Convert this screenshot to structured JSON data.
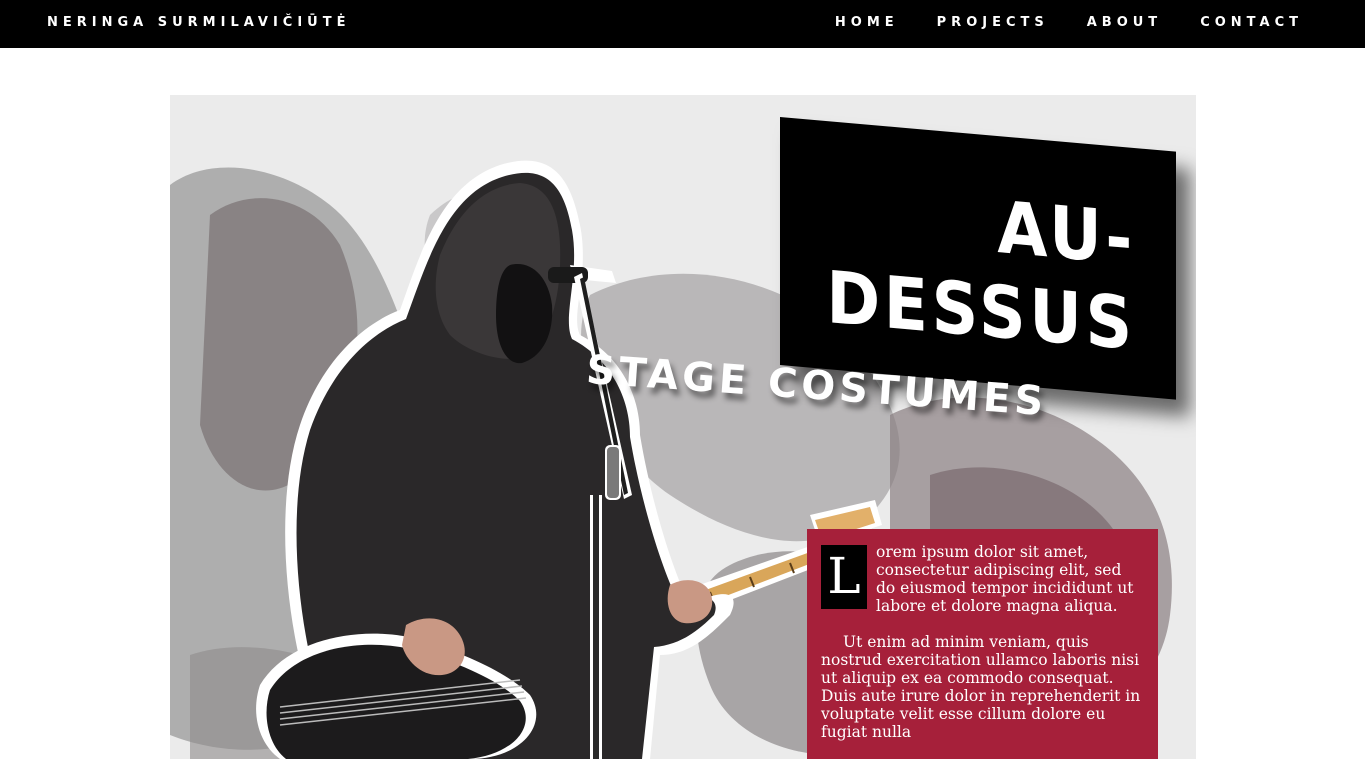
{
  "nav": {
    "brand": "NERINGA SURMILAVIČIŪTĖ",
    "links": [
      "HOME",
      "PROJECTS",
      "ABOUT",
      "CONTACT"
    ]
  },
  "hero": {
    "title_line_1": "AU-",
    "title_line_2": "DESSUS",
    "subtitle": "STAGE COSTUMES",
    "image_subject": "hooded bass guitarist at microphone stand"
  },
  "text_panel": {
    "dropcap": "L",
    "paragraph_1": "orem ipsum dolor sit amet, consectetur adipiscing elit, sed do eiusmod tempor incididunt ut labore et dolore magna aliqua.",
    "paragraph_2": "Ut enim ad minim veniam, quis nostrud exercitation ullamco laboris nisi ut aliquip ex ea commodo consequat. Duis aute irure dolor in reprehenderit in voluptate velit esse cillum dolore eu fugiat nulla"
  },
  "colors": {
    "nav_bg": "#000000",
    "panel_red": "#a6203a",
    "title_block": "#000000"
  }
}
